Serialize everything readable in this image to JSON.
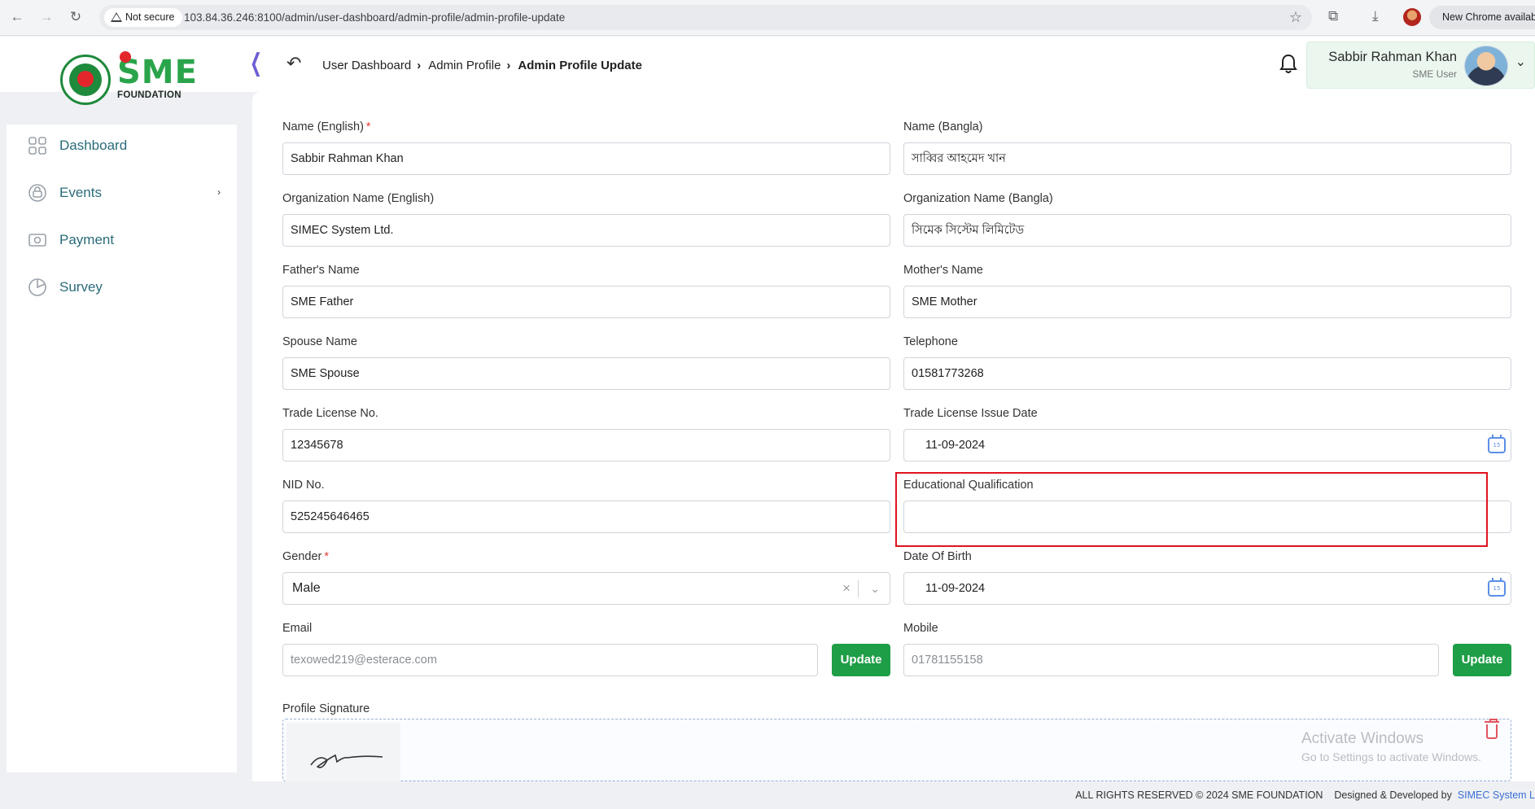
{
  "browser": {
    "security_label": "Not secure",
    "url": "103.84.36.246:8100/admin/user-dashboard/admin-profile/admin-profile-update",
    "new_chrome_label": "New Chrome available"
  },
  "header": {
    "logo_text": "SME",
    "logo_subtitle": "FOUNDATION",
    "breadcrumb": [
      "User Dashboard",
      "Admin Profile",
      "Admin Profile Update"
    ],
    "user_name": "Sabbir Rahman Khan",
    "user_role": "SME User"
  },
  "sidebar": {
    "items": [
      {
        "label": "Dashboard",
        "icon": "grid-icon"
      },
      {
        "label": "Events",
        "icon": "events-icon",
        "has_submenu": true
      },
      {
        "label": "Payment",
        "icon": "payment-icon"
      },
      {
        "label": "Survey",
        "icon": "pie-chart-icon"
      }
    ]
  },
  "form": {
    "name_en": {
      "label": "Name (English)",
      "required": "*",
      "value": "Sabbir Rahman Khan"
    },
    "name_bn": {
      "label": "Name (Bangla)",
      "value": "সাব্বির আহমেদ খান"
    },
    "org_en": {
      "label": "Organization Name (English)",
      "value": "SIMEC System Ltd."
    },
    "org_bn": {
      "label": "Organization Name (Bangla)",
      "value": "সিমেক সিস্টেম লিমিটেড"
    },
    "father": {
      "label": "Father's Name",
      "value": "SME Father"
    },
    "mother": {
      "label": "Mother's Name",
      "value": "SME Mother"
    },
    "spouse": {
      "label": "Spouse Name",
      "value": "SME Spouse"
    },
    "telephone": {
      "label": "Telephone",
      "value": "01581773268"
    },
    "trade_license": {
      "label": "Trade License No.",
      "value": "12345678"
    },
    "trade_license_date": {
      "label": "Trade License Issue Date",
      "value": "11-09-2024"
    },
    "nid": {
      "label": "NID No.",
      "value": "525245646465"
    },
    "education": {
      "label": "Educational Qualification",
      "value": ""
    },
    "gender": {
      "label": "Gender",
      "required": "*",
      "value": "Male"
    },
    "dob": {
      "label": "Date Of Birth",
      "value": "11-09-2024"
    },
    "email": {
      "label": "Email",
      "value": "texowed219@esterace.com"
    },
    "mobile": {
      "label": "Mobile",
      "value": "01781155158"
    },
    "update_label": "Update",
    "signature_label": "Profile Signature"
  },
  "watermark": {
    "title": "Activate Windows",
    "subtitle": "Go to Settings to activate Windows."
  },
  "footer": {
    "rights": "ALL RIGHTS RESERVED © 2024 SME FOUNDATION",
    "designed_by": "Designed & Developed by",
    "developer": "SIMEC System L"
  },
  "colors": {
    "accent_green": "#1e9e47",
    "highlight_red": "#e0141e",
    "sidebar_text": "#2a6b7a"
  }
}
